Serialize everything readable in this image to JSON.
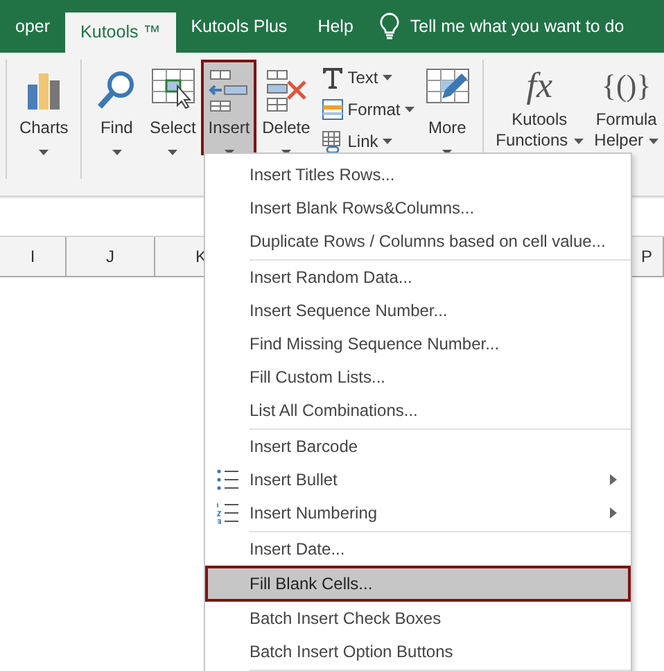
{
  "tabs": [
    {
      "label": "oper",
      "selected": false
    },
    {
      "label": "Kutools ™",
      "selected": true
    },
    {
      "label": "Kutools Plus",
      "selected": false
    },
    {
      "label": "Help",
      "selected": false
    }
  ],
  "tell_me": "Tell me what you want to do",
  "ribbon": [
    {
      "kind": "big",
      "label": [
        "Charts"
      ],
      "dropdown": true,
      "pressed": false,
      "sep_after": true
    },
    {
      "kind": "big",
      "label": [
        "Find"
      ],
      "dropdown": true,
      "pressed": false,
      "sep_after": false
    },
    {
      "kind": "big",
      "label": [
        "Select"
      ],
      "dropdown": true,
      "pressed": false,
      "sep_after": false
    },
    {
      "kind": "big",
      "label": [
        "Insert"
      ],
      "dropdown": true,
      "pressed": true,
      "sep_after": false
    },
    {
      "kind": "big",
      "label": [
        "Delete"
      ],
      "dropdown": true,
      "pressed": false,
      "sep_after": false
    },
    {
      "kind": "stack",
      "items": [
        {
          "label": "Text",
          "dropdown": true
        },
        {
          "label": "Format",
          "dropdown": true
        },
        {
          "label": "Link",
          "dropdown": true
        }
      ],
      "sep_after": false
    },
    {
      "kind": "big",
      "label": [
        "More"
      ],
      "dropdown": true,
      "pressed": false,
      "sep_after": true
    },
    {
      "kind": "glyph",
      "glyph": "fx",
      "label": [
        "Kutools",
        "Functions"
      ],
      "dropdown": true,
      "pressed": false,
      "sep_after": false
    },
    {
      "kind": "glyph",
      "glyph": "{()}",
      "label": [
        "Formula",
        "Helper"
      ],
      "dropdown": true,
      "pressed": false,
      "sep_after": false
    }
  ],
  "columns": [
    "I",
    "J",
    "K",
    "P"
  ],
  "menu": [
    [
      {
        "label": "Insert Titles Rows...",
        "kind": "plain",
        "selected": false,
        "submenu": false
      },
      {
        "label": "Insert Blank Rows&Columns...",
        "kind": "plain",
        "selected": false,
        "submenu": false
      },
      {
        "label": "Duplicate Rows / Columns based on cell value...",
        "kind": "plain",
        "selected": false,
        "submenu": false
      }
    ],
    [
      {
        "label": "Insert Random Data...",
        "kind": "plain",
        "selected": false,
        "submenu": false
      },
      {
        "label": "Insert Sequence Number...",
        "kind": "plain",
        "selected": false,
        "submenu": false
      },
      {
        "label": "Find Missing Sequence Number...",
        "kind": "plain",
        "selected": false,
        "submenu": false
      },
      {
        "label": "Fill Custom Lists...",
        "kind": "plain",
        "selected": false,
        "submenu": false
      },
      {
        "label": "List All Combinations...",
        "kind": "plain",
        "selected": false,
        "submenu": false
      }
    ],
    [
      {
        "label": "Insert Barcode",
        "kind": "plain",
        "selected": false,
        "submenu": false
      },
      {
        "label": "Insert Bullet",
        "kind": "bullet",
        "selected": false,
        "submenu": true
      },
      {
        "label": "Insert Numbering",
        "kind": "numbering",
        "selected": false,
        "submenu": true
      }
    ],
    [
      {
        "label": "Insert Date...",
        "kind": "plain",
        "selected": false,
        "submenu": false
      },
      {
        "label": "Fill Blank Cells...",
        "kind": "plain",
        "selected": true,
        "submenu": false
      },
      {
        "label": "Batch Insert Check Boxes",
        "kind": "plain",
        "selected": false,
        "submenu": false
      },
      {
        "label": "Batch Insert Option Buttons",
        "kind": "plain",
        "selected": false,
        "submenu": false
      }
    ]
  ]
}
